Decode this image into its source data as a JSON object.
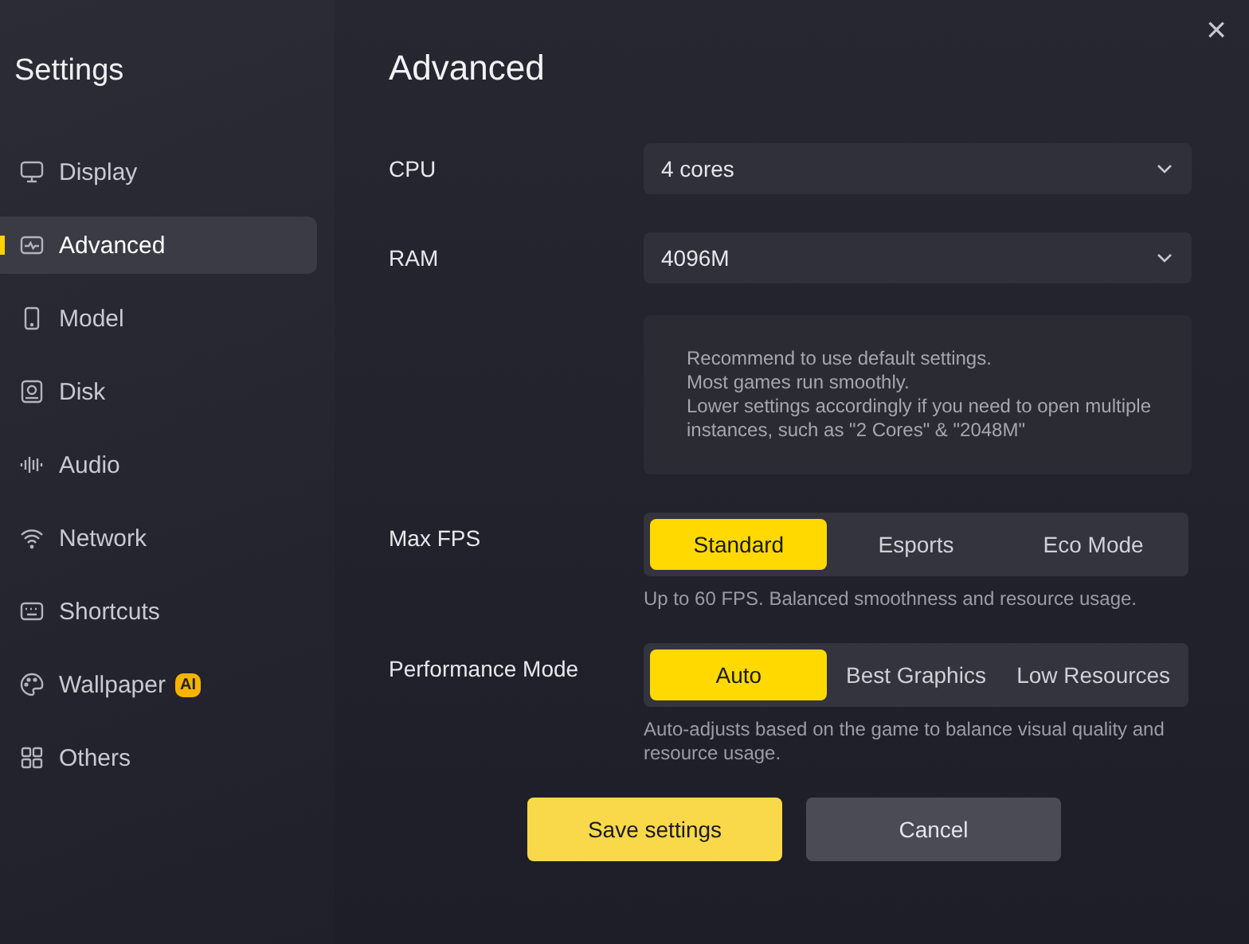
{
  "sidebar": {
    "title": "Settings",
    "items": [
      {
        "label": "Display",
        "selected": false
      },
      {
        "label": "Advanced",
        "selected": true
      },
      {
        "label": "Model",
        "selected": false
      },
      {
        "label": "Disk",
        "selected": false
      },
      {
        "label": "Audio",
        "selected": false
      },
      {
        "label": "Network",
        "selected": false
      },
      {
        "label": "Shortcuts",
        "selected": false
      },
      {
        "label": "Wallpaper",
        "selected": false,
        "badge": "AI"
      },
      {
        "label": "Others",
        "selected": false
      }
    ]
  },
  "close": "×",
  "page": {
    "title": "Advanced",
    "dropdowns": [
      {
        "label": "CPU",
        "value": "4 cores"
      },
      {
        "label": "RAM",
        "value": "4096M"
      }
    ],
    "hint": [
      "Recommend to use default settings.",
      "Most games run smoothly.",
      "Lower settings accordingly if you need to open multiple instances, such as \"2 Cores\" & \"2048M\""
    ],
    "segments": [
      {
        "label": "Max FPS",
        "options": [
          {
            "label": "Standard",
            "selected": true
          },
          {
            "label": "Esports",
            "selected": false
          },
          {
            "label": "Eco Mode",
            "selected": false
          }
        ],
        "description": "Up to 60 FPS. Balanced smoothness and resource usage."
      },
      {
        "label": "Performance Mode",
        "options": [
          {
            "label": "Auto",
            "selected": true
          },
          {
            "label": "Best Graphics",
            "selected": false
          },
          {
            "label": "Low Resources",
            "selected": false
          }
        ],
        "description": "Auto-adjusts based on the game to balance visual quality and resource usage."
      }
    ]
  },
  "buttons": [
    {
      "label": "Save settings",
      "kind": "primary"
    },
    {
      "label": "Cancel",
      "kind": "secondary"
    }
  ]
}
